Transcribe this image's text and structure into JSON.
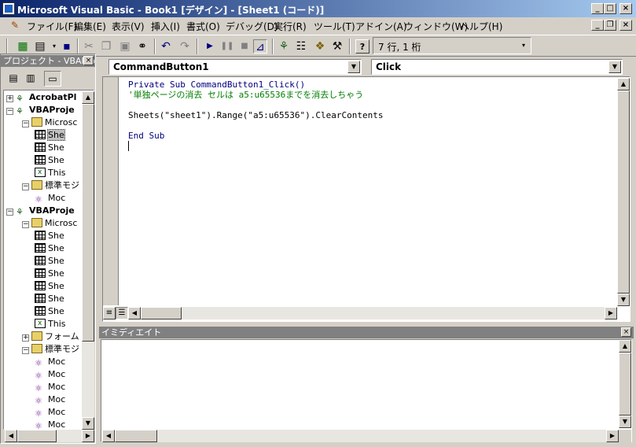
{
  "window": {
    "title": "Microsoft Visual Basic - Book1 [デザイン] - [Sheet1 (コード)]",
    "min": "_",
    "max": "□",
    "close": "×"
  },
  "mdi": {
    "min": "_",
    "restore": "❐",
    "close": "×"
  },
  "menu": [
    "ファイル(F)",
    "編集(E)",
    "表示(V)",
    "挿入(I)",
    "書式(O)",
    "デバッグ(D)",
    "実行(R)",
    "ツール(T)",
    "アドイン(A)",
    "ウィンドウ(W)",
    "ヘルプ(H)"
  ],
  "toolbar": {
    "status": "7 行, 1 桁"
  },
  "project": {
    "title": "プロジェクト - VBAProject",
    "close": "×",
    "nodes": [
      {
        "label": "AcrobatPl",
        "type": "proj",
        "bold": true,
        "exp": "+"
      },
      {
        "label": "VBAProje",
        "type": "proj",
        "bold": true,
        "exp": "−"
      },
      {
        "label": "Microsc",
        "type": "folder",
        "exp": "−"
      },
      {
        "label": "She",
        "type": "sheet",
        "selected": true
      },
      {
        "label": "She",
        "type": "sheet"
      },
      {
        "label": "She",
        "type": "sheet"
      },
      {
        "label": "This",
        "type": "book"
      },
      {
        "label": "標準モジ",
        "type": "folder",
        "exp": "−"
      },
      {
        "label": "Moc",
        "type": "mod"
      },
      {
        "label": "VBAProje",
        "type": "proj",
        "bold": true,
        "exp": "−"
      },
      {
        "label": "Microsc",
        "type": "folder",
        "exp": "−"
      },
      {
        "label": "She",
        "type": "sheet"
      },
      {
        "label": "She",
        "type": "sheet"
      },
      {
        "label": "She",
        "type": "sheet"
      },
      {
        "label": "She",
        "type": "sheet"
      },
      {
        "label": "She",
        "type": "sheet"
      },
      {
        "label": "She",
        "type": "sheet"
      },
      {
        "label": "She",
        "type": "sheet"
      },
      {
        "label": "This",
        "type": "book"
      },
      {
        "label": "フォーム",
        "type": "folder",
        "exp": "+"
      },
      {
        "label": "標準モジ",
        "type": "folder",
        "exp": "−"
      },
      {
        "label": "Moc",
        "type": "mod"
      },
      {
        "label": "Moc",
        "type": "mod"
      },
      {
        "label": "Moc",
        "type": "mod"
      },
      {
        "label": "Moc",
        "type": "mod"
      },
      {
        "label": "Moc",
        "type": "mod"
      },
      {
        "label": "Moc",
        "type": "mod"
      }
    ]
  },
  "code": {
    "object": "CommandButton1",
    "procedure": "Click",
    "lines": {
      "l1": "Private Sub CommandButton1_Click()",
      "l2": "'単独ページの消去 セルは a5:u65536までを消去しちゃう",
      "l3": "Sheets(\"sheet1\").Range(\"a5:u65536\").ClearContents",
      "l4": "End Sub"
    }
  },
  "immediate": {
    "title": "イミディエイト",
    "close": "×"
  },
  "icons": {
    "excel": "excel-icon",
    "insert": "insert-module-icon",
    "save": "save-icon",
    "cut": "cut-icon",
    "copy": "copy-icon",
    "paste": "paste-icon",
    "find": "find-icon",
    "undo": "undo-icon",
    "redo": "redo-icon",
    "run": "run-icon",
    "pause": "pause-icon",
    "reset": "reset-icon",
    "design": "design-mode-icon",
    "explorer": "project-explorer-icon",
    "props": "properties-icon",
    "objbrowser": "object-browser-icon",
    "toolbox": "toolbox-icon",
    "help": "help-icon"
  }
}
